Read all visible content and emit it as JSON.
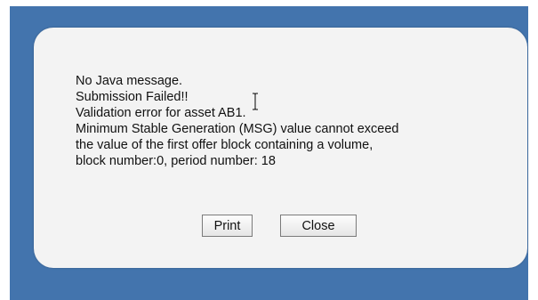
{
  "dialog": {
    "message_lines": [
      "No Java message.",
      "Submission Failed!!",
      "Validation error for asset AB1.",
      "Minimum Stable Generation (MSG) value cannot exceed",
      "the value of the first offer block containing a volume,",
      "block number:0, period number: 18"
    ],
    "buttons": {
      "print_label": "Print",
      "close_label": "Close"
    }
  },
  "colors": {
    "frame_background": "#4374ad",
    "dialog_background": "#f3f3f3"
  },
  "icons": {
    "cursor": "text-cursor-icon"
  }
}
